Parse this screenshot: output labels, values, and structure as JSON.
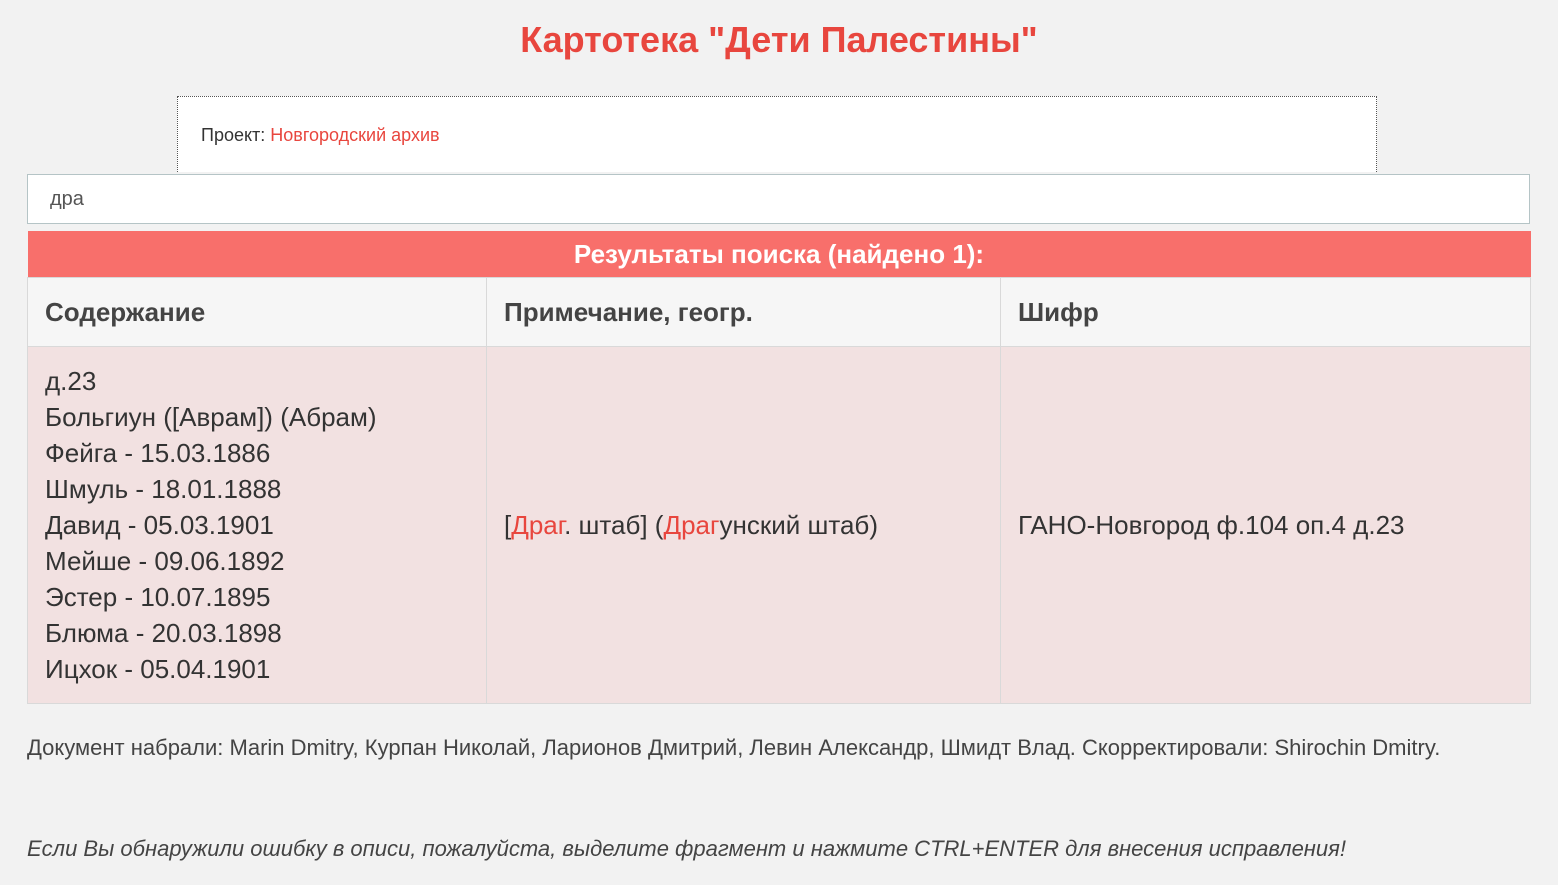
{
  "page": {
    "title": "Картотека \"Дети Палестины\""
  },
  "project": {
    "label": "Проект: ",
    "link_text": "Новгородский архив"
  },
  "search": {
    "value": "дра"
  },
  "results": {
    "caption": "Результаты поиска (найдено 1):",
    "columns": [
      "Содержание",
      "Примечание, геогр.",
      "Шифр"
    ],
    "rows": [
      {
        "content": [
          "д.23",
          "Больгиун ([Аврам]) (Абрам)",
          "Фейга - 15.03.1886",
          "Шмуль - 18.01.1888",
          "Давид - 05.03.1901",
          "Мейше - 09.06.1892",
          "Эстер - 10.07.1895",
          "Блюма - 20.03.1898",
          "Ицхок - 05.04.1901"
        ],
        "note": {
          "p1": "[",
          "hl1": "Драг",
          "p2": ". штаб] (",
          "hl2": "Драг",
          "p3": "унский штаб)"
        },
        "cipher": "ГАНО-Новгород ф.104 оп.4 д.23"
      }
    ]
  },
  "footer": {
    "credits": "Документ набрали: Marin Dmitry, Курпан Николай, Ларионов Дмитрий, Левин Александр, Шмидт Влад. Скорректировали: Shirochin Dmitry.",
    "notice": "Если Вы обнаружили ошибку в описи, пожалуйста, выделите фрагмент и нажмите CTRL+ENTER для внесения исправления!"
  },
  "colors": {
    "accent": "#e8463e",
    "caption_bg": "#f86f6b",
    "row_bg": "#f2e1e1",
    "page_bg": "#f2f2f2"
  }
}
